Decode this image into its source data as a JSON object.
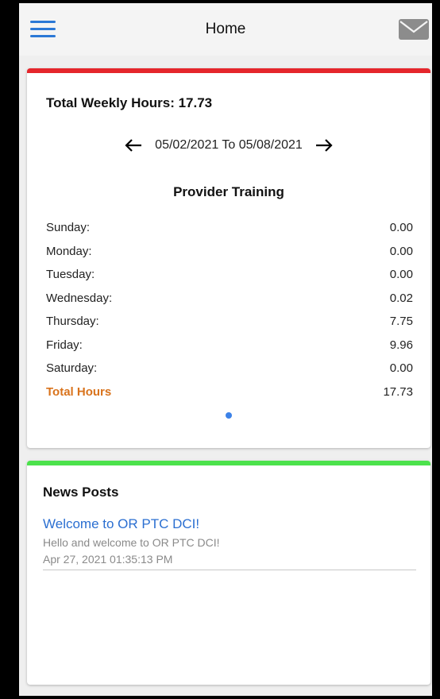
{
  "header": {
    "title": "Home"
  },
  "hours": {
    "title": "Total Weekly Hours: 17.73",
    "date_range": "05/02/2021 To 05/08/2021",
    "section_title": "Provider Training",
    "rows": [
      {
        "label": "Sunday:",
        "value": "0.00"
      },
      {
        "label": "Monday:",
        "value": "0.00"
      },
      {
        "label": "Tuesday:",
        "value": "0.00"
      },
      {
        "label": "Wednesday:",
        "value": "0.02"
      },
      {
        "label": "Thursday:",
        "value": "7.75"
      },
      {
        "label": "Friday:",
        "value": "9.96"
      },
      {
        "label": "Saturday:",
        "value": "0.00"
      }
    ],
    "total": {
      "label": "Total Hours",
      "value": "17.73"
    }
  },
  "news": {
    "title": "News Posts",
    "post": {
      "title": "Welcome to OR PTC DCI!",
      "body": "Hello and welcome to OR PTC DCI!",
      "date": "Apr 27, 2021 01:35:13 PM"
    }
  },
  "colors": {
    "hours_accent": "#e5262c",
    "news_accent": "#4ce24c",
    "link": "#2b6fd1",
    "total_label": "#d9731c"
  },
  "icons": {
    "menu": "hamburger-menu-icon",
    "mail": "mail-icon",
    "prev": "arrow-left-icon",
    "next": "arrow-right-icon"
  }
}
